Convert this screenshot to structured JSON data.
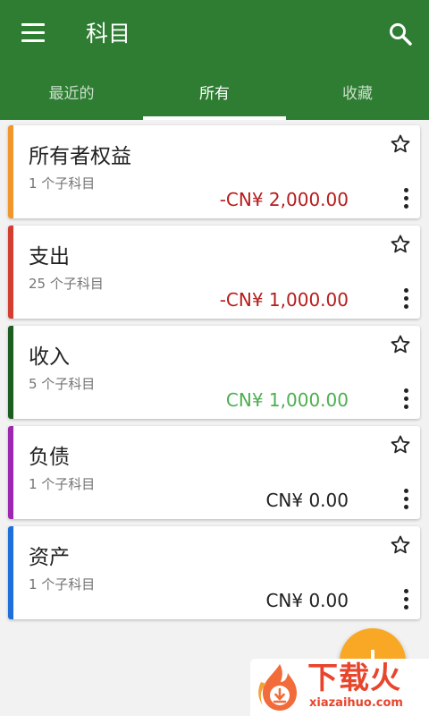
{
  "appbar": {
    "title": "科目",
    "color": "#2e7d32"
  },
  "tabs": [
    {
      "label": "最近的",
      "active": false
    },
    {
      "label": "所有",
      "active": true
    },
    {
      "label": "收藏",
      "active": false
    }
  ],
  "accounts": [
    {
      "name": "所有者权益",
      "subtitle": "1 个子科目",
      "balance": "-CN¥ 2,000.00",
      "color": "#f0962a"
    },
    {
      "name": "支出",
      "subtitle": "25 个子科目",
      "balance": "-CN¥ 1,000.00",
      "color": "#d23f31"
    },
    {
      "name": "收入",
      "subtitle": "5 个子科目",
      "balance": "CN¥ 1,000.00",
      "color": "#1b5e20"
    },
    {
      "name": "负债",
      "subtitle": "1 个子科目",
      "balance": "CN¥ 0.00",
      "color": "#9c27b0"
    },
    {
      "name": "资产",
      "subtitle": "1 个子科目",
      "balance": "CN¥ 0.00",
      "color": "#1e6fd9"
    }
  ],
  "fab": {
    "icon": "plus-icon",
    "color": "#f9a825"
  },
  "watermark": {
    "brand": "下载火",
    "url": "xiazaihuo.com"
  }
}
